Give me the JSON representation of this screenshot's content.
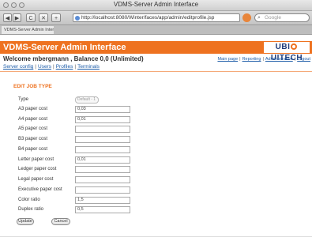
{
  "browser": {
    "window_title": "VDMS-Server Admin Interface",
    "back_label": "◀",
    "forward_label": "▶",
    "reload_label": "C",
    "stop_label": "✕",
    "add_label": "+",
    "url": "http://localhost:8080/Winter/faces/app/admin/editprofile.jsp",
    "search_placeholder": "Google",
    "tab_title": "VDMS-Server Admin Interface"
  },
  "header": {
    "title": "VDMS-Server Admin Interface",
    "logo_left": "UBI",
    "logo_right": "UITECH",
    "welcome": "Welcome mbergmann , Balance 0,0 (Unlimited)",
    "top_links": [
      "Main page",
      "Reporting",
      "Administration",
      "Logout"
    ],
    "sub_nav": [
      "Server config",
      "Users",
      "Profiles",
      "Terminals"
    ]
  },
  "section_title": "EDIT JOB TYPE",
  "form": {
    "type_label": "Type",
    "type_value": "Default - 1",
    "fields": [
      {
        "label": "A3 paper cost",
        "value": "0,03"
      },
      {
        "label": "A4 paper cost",
        "value": "0,01"
      },
      {
        "label": "A5 paper cost",
        "value": ""
      },
      {
        "label": "B3 paper cost",
        "value": ""
      },
      {
        "label": "B4 paper cost",
        "value": ""
      },
      {
        "label": "Letter paper cost",
        "value": "0,01"
      },
      {
        "label": "Ledger paper cost",
        "value": ""
      },
      {
        "label": "Legal paper cost",
        "value": ""
      },
      {
        "label": "Executive paper cost",
        "value": ""
      },
      {
        "label": "Color ratio",
        "value": "1,5"
      },
      {
        "label": "Duplex ratio",
        "value": "0,5"
      }
    ],
    "update_label": "Update",
    "cancel_label": "Cancel"
  }
}
